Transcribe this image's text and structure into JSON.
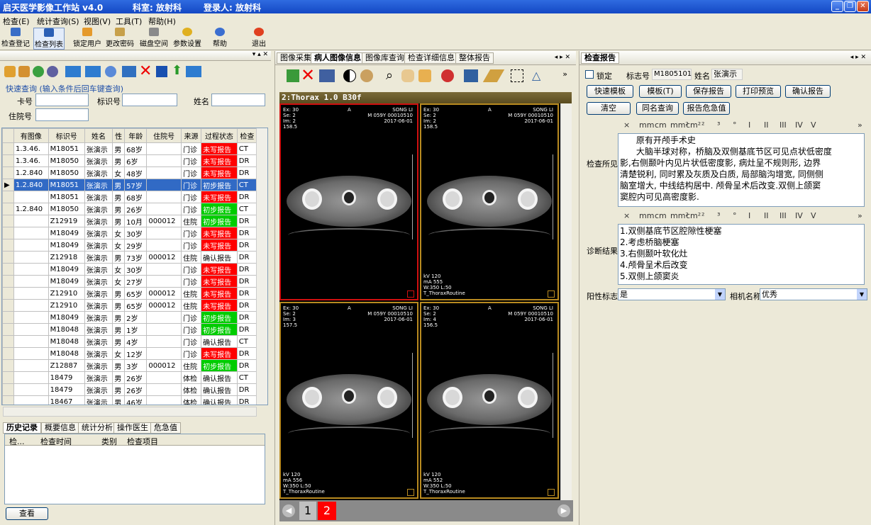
{
  "window": {
    "title": "启天医学影像工作站 v4.0",
    "dept": "科室: 放射科",
    "user": "登录人: 放射科"
  },
  "menu": [
    "检查(E)",
    "统计查询(S)",
    "视图(V)",
    "工具(T)",
    "帮助(H)"
  ],
  "toolbar": [
    {
      "label": "检查登记",
      "icon": "register-icon",
      "color": "#3a6ec7"
    },
    {
      "label": "检查列表",
      "icon": "list-icon",
      "color": "#2b5fb5"
    },
    {
      "label": "锁定用户",
      "icon": "lock-user-icon",
      "color": "#e59a2b"
    },
    {
      "label": "更改密码",
      "icon": "key-icon",
      "color": "#c7a04a"
    },
    {
      "label": "磁盘空间",
      "icon": "disk-icon",
      "color": "#8a8a8a"
    },
    {
      "label": "参数设置",
      "icon": "gear-icon",
      "color": "#e0b020"
    },
    {
      "label": "帮助",
      "icon": "help-icon",
      "color": "#3b6ed0"
    },
    {
      "label": "退出",
      "icon": "exit-icon",
      "color": "#e04020"
    }
  ],
  "quick": {
    "title": "快速查询 (输入条件后回车键查询)",
    "card_label": "卡号",
    "mark_label": "标识号",
    "name_label": "姓名",
    "inpatient_label": "住院号"
  },
  "table": {
    "headers": [
      "有图像",
      "标识号",
      "姓名",
      "性",
      "年龄",
      "住院号",
      "来源",
      "过程状态",
      "检查"
    ],
    "rows": [
      {
        "img": "1.3.46.",
        "id": "M18051",
        "name": "张演示",
        "sex": "男",
        "age": "68岁",
        "inp": "",
        "src": "门诊",
        "status": "未写报告",
        "st": "red",
        "type": "CT"
      },
      {
        "img": "1.3.46.",
        "id": "M18050",
        "name": "张演示",
        "sex": "男",
        "age": "6岁",
        "inp": "",
        "src": "门诊",
        "status": "未写报告",
        "st": "red",
        "type": "DR"
      },
      {
        "img": "1.2.840",
        "id": "M18050",
        "name": "张演示",
        "sex": "女",
        "age": "48岁",
        "inp": "",
        "src": "门诊",
        "status": "未写报告",
        "st": "red",
        "type": "DR"
      },
      {
        "img": "1.2.840",
        "id": "M18051",
        "name": "张演示",
        "sex": "男",
        "age": "57岁",
        "inp": "",
        "src": "门诊",
        "status": "初步报告",
        "st": "sel",
        "type": "CT"
      },
      {
        "img": "",
        "id": "M18051",
        "name": "张演示",
        "sex": "男",
        "age": "68岁",
        "inp": "",
        "src": "门诊",
        "status": "未写报告",
        "st": "red",
        "type": "DR"
      },
      {
        "img": "1.2.840",
        "id": "M18050",
        "name": "张演示",
        "sex": "男",
        "age": "26岁",
        "inp": "",
        "src": "门诊",
        "status": "初步报告",
        "st": "green",
        "type": "CT"
      },
      {
        "img": "",
        "id": "Z12919",
        "name": "张演示",
        "sex": "男",
        "age": "10月",
        "inp": "000012",
        "src": "住院",
        "status": "初步报告",
        "st": "green",
        "type": "DR"
      },
      {
        "img": "",
        "id": "M18049",
        "name": "张演示",
        "sex": "女",
        "age": "30岁",
        "inp": "",
        "src": "门诊",
        "status": "未写报告",
        "st": "red",
        "type": "DR"
      },
      {
        "img": "",
        "id": "M18049",
        "name": "张演示",
        "sex": "女",
        "age": "29岁",
        "inp": "",
        "src": "门诊",
        "status": "未写报告",
        "st": "red",
        "type": "DR"
      },
      {
        "img": "",
        "id": "Z12918",
        "name": "张演示",
        "sex": "男",
        "age": "73岁",
        "inp": "000012",
        "src": "住院",
        "status": "确认报告",
        "st": "",
        "type": "DR"
      },
      {
        "img": "",
        "id": "M18049",
        "name": "张演示",
        "sex": "女",
        "age": "30岁",
        "inp": "",
        "src": "门诊",
        "status": "未写报告",
        "st": "red",
        "type": "DR"
      },
      {
        "img": "",
        "id": "M18049",
        "name": "张演示",
        "sex": "女",
        "age": "27岁",
        "inp": "",
        "src": "门诊",
        "status": "未写报告",
        "st": "red",
        "type": "DR"
      },
      {
        "img": "",
        "id": "Z12910",
        "name": "张演示",
        "sex": "男",
        "age": "65岁",
        "inp": "000012",
        "src": "住院",
        "status": "未写报告",
        "st": "red",
        "type": "DR"
      },
      {
        "img": "",
        "id": "Z12910",
        "name": "张演示",
        "sex": "男",
        "age": "65岁",
        "inp": "000012",
        "src": "住院",
        "status": "未写报告",
        "st": "red",
        "type": "DR"
      },
      {
        "img": "",
        "id": "M18049",
        "name": "张演示",
        "sex": "男",
        "age": "2岁",
        "inp": "",
        "src": "门诊",
        "status": "初步报告",
        "st": "green",
        "type": "DR"
      },
      {
        "img": "",
        "id": "M18048",
        "name": "张演示",
        "sex": "男",
        "age": "1岁",
        "inp": "",
        "src": "门诊",
        "status": "初步报告",
        "st": "green",
        "type": "DR"
      },
      {
        "img": "",
        "id": "M18048",
        "name": "张演示",
        "sex": "男",
        "age": "4岁",
        "inp": "",
        "src": "门诊",
        "status": "确认报告",
        "st": "",
        "type": "CT"
      },
      {
        "img": "",
        "id": "M18048",
        "name": "张演示",
        "sex": "女",
        "age": "12岁",
        "inp": "",
        "src": "门诊",
        "status": "未写报告",
        "st": "red",
        "type": "DR"
      },
      {
        "img": "",
        "id": "Z12887",
        "name": "张演示",
        "sex": "男",
        "age": "3岁",
        "inp": "000012",
        "src": "住院",
        "status": "初步报告",
        "st": "green",
        "type": "DR"
      },
      {
        "img": "",
        "id": "18479",
        "name": "张演示",
        "sex": "男",
        "age": "26岁",
        "inp": "",
        "src": "体检",
        "status": "确认报告",
        "st": "",
        "type": "CT"
      },
      {
        "img": "",
        "id": "18479",
        "name": "张演示",
        "sex": "男",
        "age": "26岁",
        "inp": "",
        "src": "体检",
        "status": "确认报告",
        "st": "",
        "type": "DR"
      },
      {
        "img": "",
        "id": "18467",
        "name": "张演示",
        "sex": "男",
        "age": "46岁",
        "inp": "",
        "src": "体检",
        "status": "确认报告",
        "st": "",
        "type": "DR"
      }
    ]
  },
  "bottom_tabs": [
    "历史记录",
    "概要信息",
    "统计分析",
    "操作医生",
    "危急值"
  ],
  "history_headers": [
    "检...",
    "检查时间",
    "类别",
    "检查项目"
  ],
  "view_btn": "查看",
  "center_tabs": [
    "图像采集",
    "病人图像信息",
    "图像库查询",
    "检查详细信息",
    "整体报告"
  ],
  "series_title": "2:Thorax  1.0  B30f",
  "images": [
    {
      "tl": [
        "Ex: 30",
        "Se: 2",
        "Im: 2",
        "158.5"
      ],
      "tc": "A",
      "tr": [
        "SONG LI",
        "M 059Y 00010510",
        "2017-06-01"
      ],
      "bl": [],
      "sel": true
    },
    {
      "tl": [
        "Ex: 30",
        "Se: 2",
        "Im: 2",
        "158.5"
      ],
      "tc": "A",
      "tr": [
        "SONG LI",
        "M 059Y 00010510",
        "2017-06-01"
      ],
      "bl": [
        "kV 120",
        "mA 555",
        "W:350 L:50",
        "T_ThoraxRoutine"
      ],
      "sel": false
    },
    {
      "tl": [
        "Ex: 30",
        "Se: 2",
        "Im: 3",
        "157.5"
      ],
      "tc": "A",
      "tr": [
        "SONG LI",
        "M 059Y 00010510",
        "2017-06-01"
      ],
      "bl": [
        "kV 120",
        "mA 556",
        "W:350 L:50",
        "T_ThoraxRoutine"
      ],
      "sel": false
    },
    {
      "tl": [
        "Ex: 30",
        "Se: 2",
        "Im: 4",
        "156.5"
      ],
      "tc": "A",
      "tr": [
        "SONG LI",
        "M 059Y 00010510",
        "2017-06-01"
      ],
      "bl": [
        "kV 120",
        "mA 552",
        "W:350 L:50",
        "T_ThoraxRoutine"
      ],
      "sel": false
    }
  ],
  "pages": [
    "1",
    "2"
  ],
  "report": {
    "tab": "检查报告",
    "lock_label": "锁定",
    "mark_label": "标志号",
    "mark_value": "M1805101",
    "name_label": "姓名",
    "name_value": "张演示",
    "buttons1": [
      "快速模板",
      "模板(T)",
      "保存报告",
      "打印预览",
      "确认报告"
    ],
    "buttons2": [
      "清空",
      "同名查询",
      "报告危急值"
    ],
    "fmt": [
      "×",
      "mm",
      "cm",
      "mm²",
      "cm²",
      "²",
      "³",
      "°",
      "I",
      "II",
      "III",
      "IV",
      "V",
      "»"
    ],
    "findings_label": "检查所见",
    "findings": [
      "      原有开颅手术史",
      "      大脑半球对称，桥脑及双侧基底节区可见点状低密度",
      "影,右侧颞叶内见片状低密度影, 病灶呈不规则形, 边界",
      "清楚锐利, 同时累及灰质及白质, 局部脑沟增宽, 同侧侧",
      "脑室增大, 中线结构居中. 颅骨呈术后改变.双侧上颌窦",
      "窦腔内可见高密度影."
    ],
    "diag_label": "诊断结果",
    "diag": [
      "1.双侧基底节区腔隙性梗塞",
      "2.考虑桥脑梗塞",
      "3.右侧颞叶软化灶",
      "4.颅骨呈术后改变",
      "5.双侧上颌窦炎"
    ],
    "positive_label": "阳性标志",
    "positive_value": "是",
    "camera_label": "相机名称",
    "camera_value": "优秀"
  }
}
